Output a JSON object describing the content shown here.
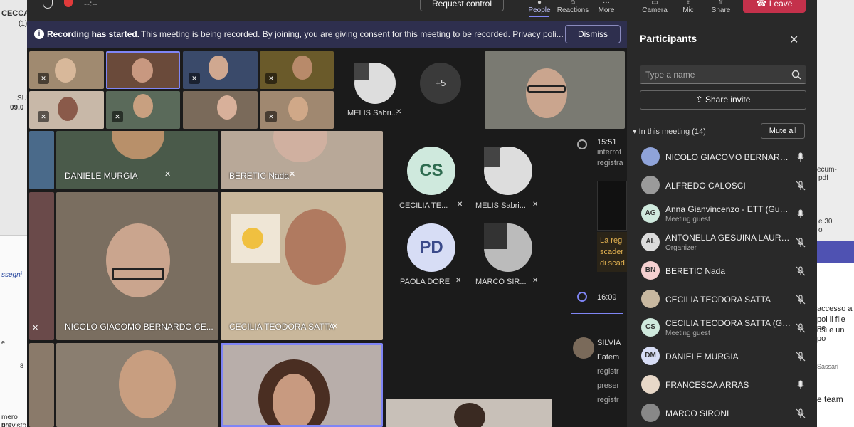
{
  "desktop_left": {
    "t1": "CECCA",
    "t2": "(1)",
    "t3": "SU",
    "t4": "09.0",
    "doc_title": "ssegni_",
    "doc_e": "e",
    "doc_8": "8",
    "doc_bottom1": "mero pro",
    "doc_bottom2": "previsto"
  },
  "desktop_right": {
    "r1": "ecum-",
    "r2": "pdf",
    "r3": "e 30",
    "r4": "o",
    "p1": "accesso a",
    "p2": "poi il file pe",
    "p3": "osi e un po",
    "p4": "Sassari",
    "p5": "e team"
  },
  "topbar": {
    "timer": "--:--",
    "request_control": "Request control",
    "people": "People",
    "reactions": "Reactions",
    "more": "More",
    "camera": "Camera",
    "mic": "Mic",
    "share": "Share",
    "leave": "Leave"
  },
  "banner": {
    "title": "Recording has started.",
    "text": "This meeting is being recorded. By joining, you are giving consent for this meeting to be recorded.",
    "link": "Privacy poli...",
    "dismiss": "Dismiss"
  },
  "stage": {
    "overflow_count": "+5",
    "melis_top": "MELIS Sabri...",
    "tiles": {
      "daniele": "DANIELE MURGIA",
      "beretic": "BERETIC Nada",
      "nicolo": "NICOLO GIACOMO BERNARDO CE...",
      "cecilia": "CECILIA TEODORA SATTA"
    },
    "avatars": [
      {
        "initials": "CS",
        "label": "CECILIA TE...",
        "color": "#cfe9dd",
        "text": "#2e6b4f"
      },
      {
        "initials": "",
        "label": "MELIS Sabri...",
        "color": "#dddddd",
        "text": "#333"
      },
      {
        "initials": "PD",
        "label": "PAOLA DORE",
        "color": "#d7ddf5",
        "text": "#3a4a8a"
      },
      {
        "initials": "",
        "label": "MARCO SIR...",
        "color": "#bbbbbb",
        "text": "#333"
      }
    ]
  },
  "chat": {
    "time1": "15:51",
    "line1a": "interrot",
    "line1b": "registra",
    "yellow1": "La reg",
    "yellow2": "scader",
    "yellow3": "di scad",
    "time2": "16:09",
    "sender": "SILVIA",
    "msg1": "Fatem",
    "msg2": "registr",
    "msg3": "preser",
    "msg4": "registr"
  },
  "participants": {
    "title": "Participants",
    "search_placeholder": "Type a name",
    "share_invite": "Share invite",
    "in_meeting": "In this meeting (14)",
    "mute_all": "Mute all",
    "list": [
      {
        "name": "NICOLO GIACOMO BERNARDO ...",
        "role": "",
        "initials": "",
        "av_color": "#8fa3d9",
        "mic": "on"
      },
      {
        "name": "ALFREDO CALOSCI",
        "role": "",
        "initials": "",
        "av_color": "#9a9a9a",
        "mic": "muted"
      },
      {
        "name": "Anna Gianvincenzo - ETT (Guest)",
        "role": "Meeting guest",
        "initials": "AG",
        "av_color": "#cfe9dd",
        "mic": "on"
      },
      {
        "name": "ANTONELLA GESUINA LAURA L...",
        "role": "Organizer",
        "initials": "AL",
        "av_color": "#dcdcdc",
        "mic": "muted"
      },
      {
        "name": "BERETIC Nada",
        "role": "",
        "initials": "BN",
        "av_color": "#f5d0d0",
        "mic": "muted"
      },
      {
        "name": "CECILIA TEODORA SATTA",
        "role": "",
        "initials": "",
        "av_color": "#c8b8a0",
        "mic": "muted"
      },
      {
        "name": "CECILIA TEODORA SATTA (Guest)",
        "role": "Meeting guest",
        "initials": "CS",
        "av_color": "#cfe9dd",
        "mic": "muted"
      },
      {
        "name": "DANIELE MURGIA",
        "role": "",
        "initials": "DM",
        "av_color": "#d7ddf5",
        "mic": "muted"
      },
      {
        "name": "FRANCESCA ARRAS",
        "role": "",
        "initials": "",
        "av_color": "#e8d8c8",
        "mic": "on"
      },
      {
        "name": "MARCO SIRONI",
        "role": "",
        "initials": "",
        "av_color": "#888888",
        "mic": "muted"
      }
    ]
  }
}
